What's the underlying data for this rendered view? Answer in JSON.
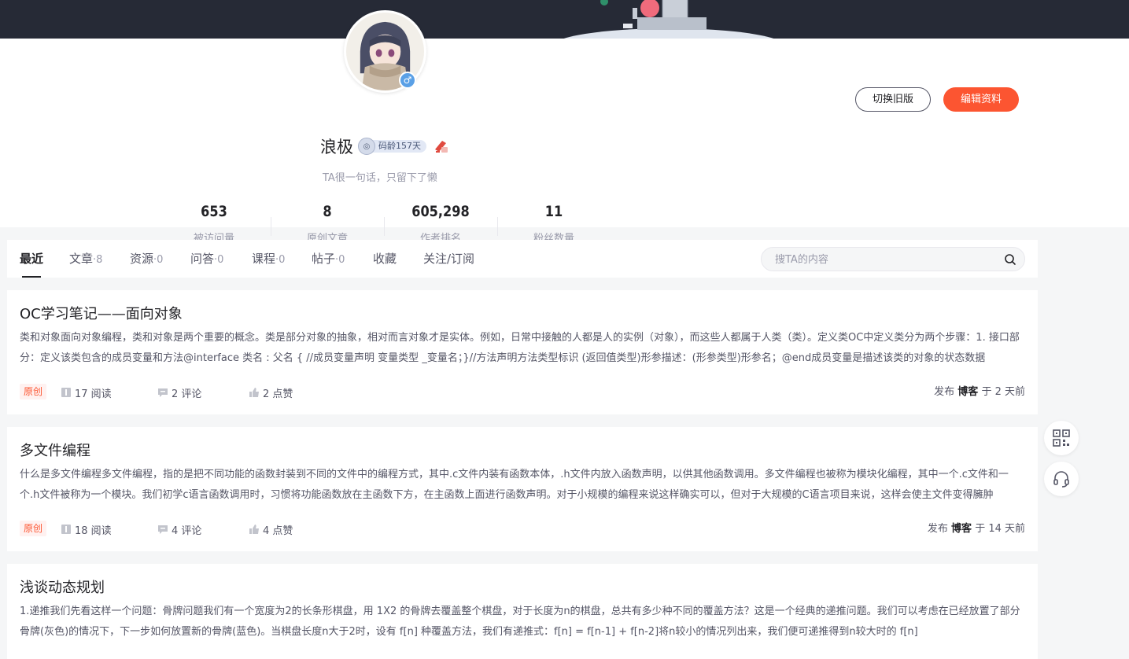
{
  "profile": {
    "username": "浪极",
    "code_age": "码龄157天",
    "bio": "TA很一句话，只留下了懒",
    "gender_symbol": "♂",
    "switch_old_label": "切换旧版",
    "edit_profile_label": "编辑资料"
  },
  "stats": [
    {
      "value": "653",
      "label": "被访问量"
    },
    {
      "value": "8",
      "label": "原创文章"
    },
    {
      "value": "605,298",
      "label": "作者排名"
    },
    {
      "value": "11",
      "label": "粉丝数量"
    }
  ],
  "tabs": [
    {
      "label": "最近",
      "count": "",
      "active": true
    },
    {
      "label": "文章",
      "count": "·8"
    },
    {
      "label": "资源",
      "count": "·0"
    },
    {
      "label": "问答",
      "count": "·0"
    },
    {
      "label": "课程",
      "count": "·0"
    },
    {
      "label": "帖子",
      "count": "·0"
    },
    {
      "label": "收藏",
      "count": ""
    },
    {
      "label": "关注/订阅",
      "count": ""
    }
  ],
  "search": {
    "placeholder": "搜TA的内容"
  },
  "articles": [
    {
      "title": "OC学习笔记——面向对象",
      "desc": "类和对象面向对象编程，类和对象是两个重要的概念。类是部分对象的抽象，相对而言对象才是实体。例如，日常中接触的人都是人的实例（对象），而这些人都属于人类（类）。定义类OC中定义类分为两个步骤：1. 接口部分：定义该类包含的成员变量和方法@interface 类名 : 父名 { //成员变量声明 变量类型 _变量名；}//方法声明方法类型标识 (返回值类型)形参描述：(形参类型)形参名；@end成员变量是描述该类的对象的状态数据",
      "badge": "原创",
      "reads": "17 阅读",
      "comments": "2 评论",
      "likes": "2 点赞",
      "pub_prefix": "发布",
      "pub_source": "博客",
      "pub_time": "于 2 天前"
    },
    {
      "title": "多文件编程",
      "desc": "什么是多文件编程多文件编程，指的是把不同功能的函数封装到不同的文件中的编程方式，其中.c文件内装有函数本体，.h文件内放入函数声明，以供其他函数调用。多文件编程也被称为模块化编程，其中一个.c文件和一个.h文件被称为一个模块。我们初学c语言函数调用时，习惯将功能函数放在主函数下方，在主函数上面进行函数声明。对于小规模的编程来说这样确实可以，但对于大规模的C语言项目来说，这样会使主文件变得臃肿",
      "badge": "原创",
      "reads": "18 阅读",
      "comments": "4 评论",
      "likes": "4 点赞",
      "pub_prefix": "发布",
      "pub_source": "博客",
      "pub_time": "于 14 天前"
    },
    {
      "title": "浅谈动态规划",
      "desc": "1.递推我们先看这样一个问题：骨牌问题我们有一个宽度为2的长条形棋盘，用 1X2 的骨牌去覆盖整个棋盘，对于长度为n的棋盘，总共有多少种不同的覆盖方法？这是一个经典的递推问题。我们可以考虑在已经放置了部分骨牌(灰色)的情况下，下一步如何放置新的骨牌(蓝色)。当棋盘长度n大于2时，设有 f[n] 种覆盖方法，我们有递推式：f[n] = f[n-1] + f[n-2]将n较小的情况列出来，我们便可递推得到n较大时的 f[n]"
    }
  ],
  "colors": {
    "accent": "#fc5531",
    "banner": "#262a36"
  }
}
